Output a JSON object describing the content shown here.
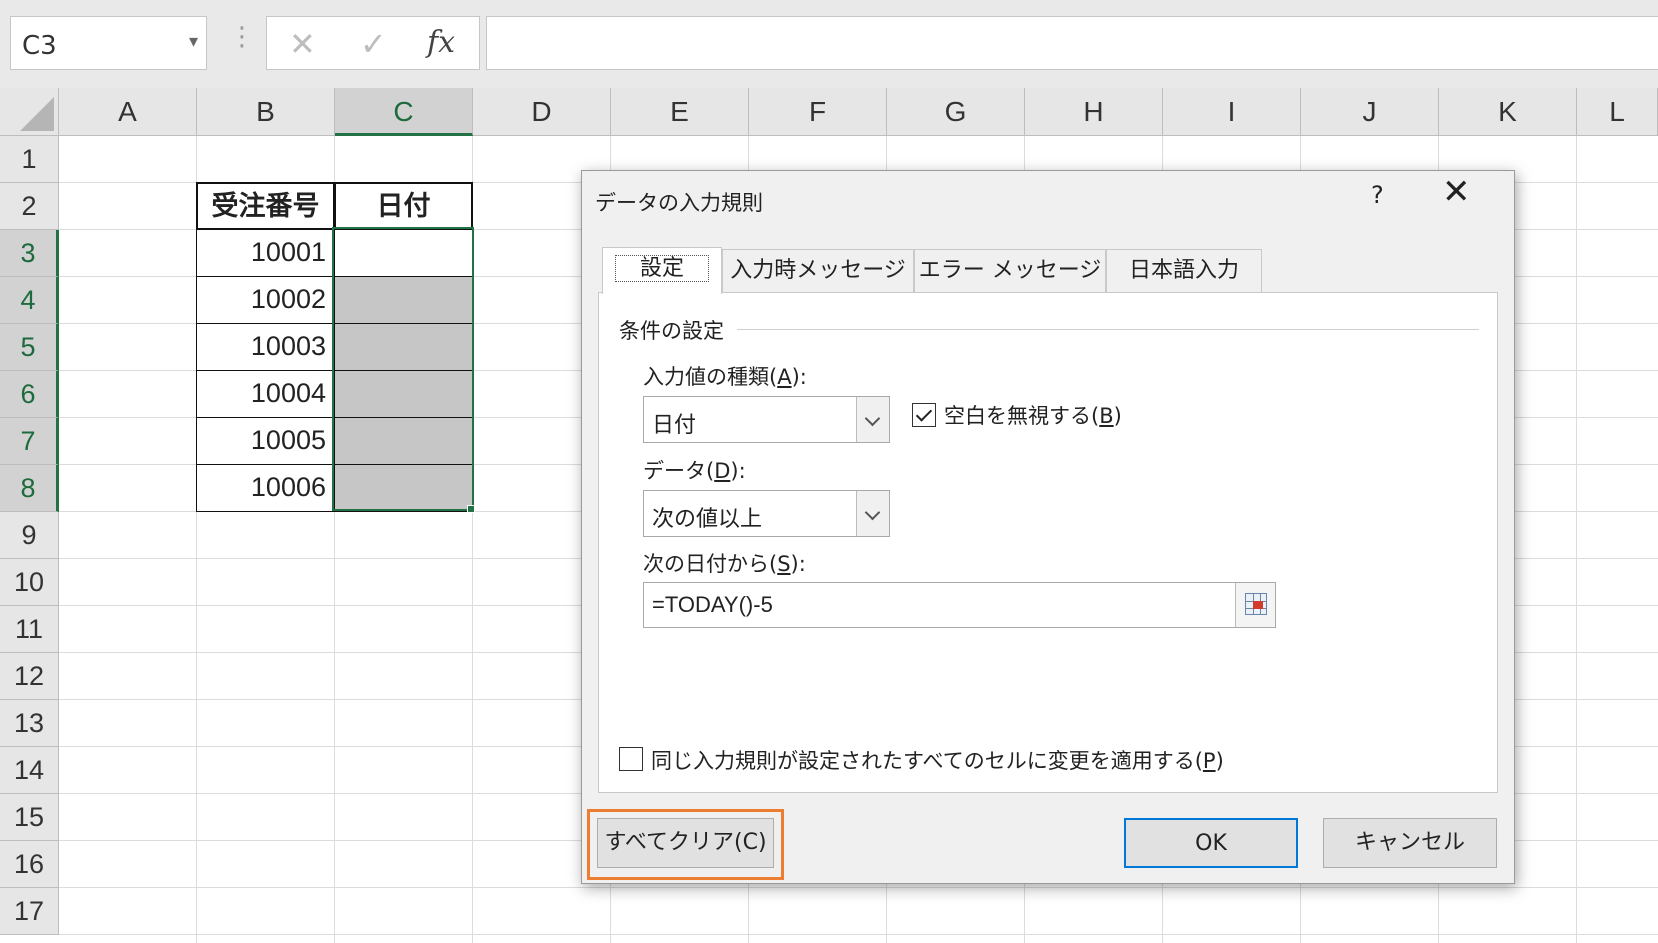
{
  "formula_bar": {
    "name_box": "C3",
    "cancel_glyph": "✕",
    "enter_glyph": "✓",
    "fx_label": "fx",
    "formula": ""
  },
  "columns": [
    "A",
    "B",
    "C",
    "D",
    "E",
    "F",
    "G",
    "H",
    "I",
    "J",
    "K",
    "L"
  ],
  "rows": [
    "1",
    "2",
    "3",
    "4",
    "5",
    "6",
    "7",
    "8",
    "9",
    "10",
    "11",
    "12",
    "13",
    "14",
    "15",
    "16",
    "17"
  ],
  "selected_column": "C",
  "table": {
    "header_b": "受注番号",
    "header_c": "日付",
    "order_numbers": [
      "10001",
      "10002",
      "10003",
      "10004",
      "10005",
      "10006"
    ]
  },
  "dialog": {
    "title": "データの入力規則",
    "help": "?",
    "close": "✕",
    "tabs": [
      {
        "label": "設定",
        "active": true
      },
      {
        "label": "入力時メッセージ",
        "active": false
      },
      {
        "label": "エラー メッセージ",
        "active": false
      },
      {
        "label": "日本語入力",
        "active": false
      }
    ],
    "group_label": "条件の設定",
    "allow_label_pre": "入力値の種類(",
    "allow_label_key": "A",
    "allow_label_post": "):",
    "allow_value": "日付",
    "ignore_blank_pre": "空白を無視する(",
    "ignore_blank_key": "B",
    "ignore_blank_post": ")",
    "ignore_blank_checked": true,
    "data_label_pre": "データ(",
    "data_label_key": "D",
    "data_label_post": "):",
    "data_value": "次の値以上",
    "start_label_pre": "次の日付から(",
    "start_label_key": "S",
    "start_label_post": "):",
    "start_value": "=TODAY()-5",
    "apply_all_pre": "同じ入力規則が設定されたすべてのセルに変更を適用する(",
    "apply_all_key": "P",
    "apply_all_post": ")",
    "apply_all_checked": false,
    "clear_all": "すべてクリア(C)",
    "ok": "OK",
    "cancel": "キャンセル"
  },
  "colors": {
    "excel_green": "#217346",
    "highlight_orange": "#ed7d31",
    "default_button_blue": "#0078d7"
  }
}
